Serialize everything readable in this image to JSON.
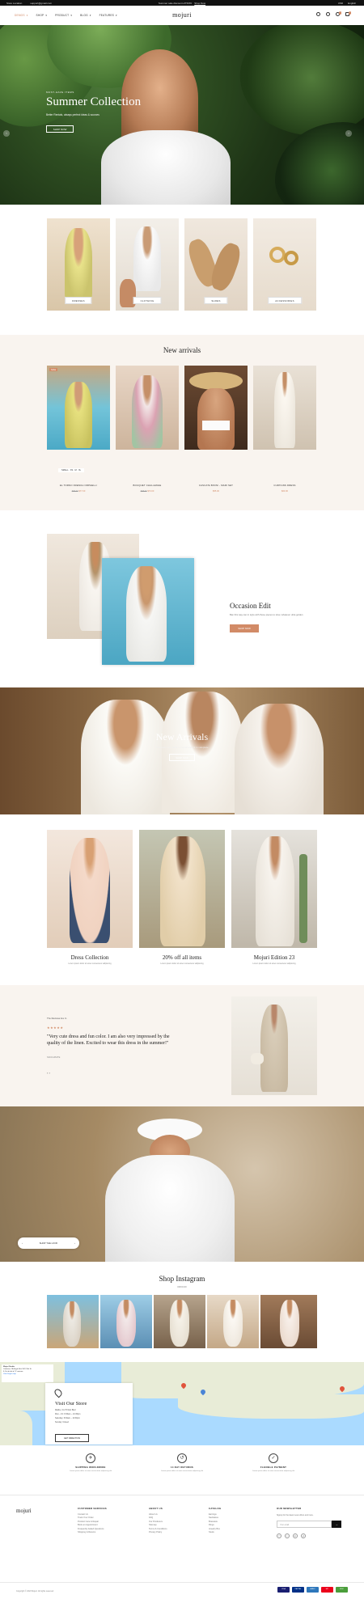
{
  "topbar": {
    "left": [
      "Store Location",
      "support@gmail.com"
    ],
    "center_text": "Summer sale discount off 50%!",
    "center_link": "Shop Now",
    "currency": "USD",
    "language": "English"
  },
  "header": {
    "logo": "mojuri",
    "nav": [
      "DEMOS",
      "SHOP",
      "PRODUCT",
      "BLOG",
      "FEATURES"
    ],
    "wishlist_count": "0",
    "cart_count": "0"
  },
  "hero": {
    "subtitle": "MUST-HAVE ITEMS",
    "title": "Summer Collection",
    "description": "Better Rentals, always perfect ideas & sources",
    "button": "SHOP NOW",
    "prev": "‹",
    "next": "›"
  },
  "categories": [
    {
      "label": "DRESSES"
    },
    {
      "label": "CLOTHING"
    },
    {
      "label": "SHOES"
    },
    {
      "label": "ACCESSORIES"
    }
  ],
  "new_arrivals": {
    "title": "New arrivals",
    "sizes": "SMALL · XS · M · XL",
    "products": [
      {
        "name": "EL TORNO FRENCH ORPHELLI",
        "old": "$95.00",
        "price": "$77.00",
        "badge": "SALE"
      },
      {
        "name": "BOUQUET CHALLENGE",
        "old": "$98.00",
        "price": "$73.00",
        "badge": ""
      },
      {
        "name": "CASCATA BIKINI - MARI SET",
        "old": "",
        "price": "$55.00",
        "badge": ""
      },
      {
        "name": "CURTAINS DRESS",
        "old": "",
        "price": "$63.00",
        "badge": ""
      }
    ]
  },
  "occasion": {
    "title": "Occasion Edit",
    "description": "Ban this way can in style with those pieces to slow, whatever ultra golden",
    "button": "SHOP NOW"
  },
  "banner2": {
    "title": "New Arrivals",
    "description": "Duis aute irure dolor in reprehenderit in voluptate",
    "button": "SHOP NOW"
  },
  "collections": [
    {
      "title": "Dress Collection",
      "desc": "Lorem ipsum dolor sit amet consectetur adipiscing"
    },
    {
      "title": "20% off all items",
      "desc": "Lorem ipsum dolor sit amet consectetur adipiscing"
    },
    {
      "title": "Mojuri Edition 23",
      "desc": "Lorem ipsum dolor sit amet consectetur adipiscing"
    }
  ],
  "testimonial": {
    "label": "The Reviews Are In",
    "stars": "★★★★★",
    "quote": "\"Very cute dress and fun color. I am also very impressed by the quality of the linen. Excited to wear this dress in the summer!\"",
    "author": "SAVIA WHITE",
    "nav": "‹   ›"
  },
  "banner3": {
    "pill_text": "SHOP THE LOOK",
    "pill_prev": "‹",
    "pill_next": "›"
  },
  "instagram": {
    "title": "Shop Instagram",
    "subtitle": "#MOJURI"
  },
  "map": {
    "info_title": "Mojuri Studio",
    "info_line1": "Oakview, CA Eagle Bch 9012 8th St",
    "info_line2": "4.6 ★★★★★  12 reviews",
    "info_link": "View larger map",
    "store_title": "Visit Our Store",
    "store_lines": [
      "Malibu, CA 70 Meri Blvd",
      "Mon – Fri: 8:30am – 10:30pm",
      "Saturday: 8:30am – 10:30pm",
      "Sunday: Closed"
    ],
    "store_button": "GET DIRECTION"
  },
  "features": [
    {
      "icon": "✈",
      "title": "SHIPPING WORLDWIDE",
      "desc": "Lorem ipsum dolor sit amet consectetur adipiscing elit"
    },
    {
      "icon": "↺",
      "title": "14 DAY RETURNS",
      "desc": "Lorem ipsum dolor sit amet consectetur adipiscing elit"
    },
    {
      "icon": "✓",
      "title": "FLEXIBLE PAYMENT",
      "desc": "Lorem ipsum dolor sit amet consectetur adipiscing elit"
    }
  ],
  "footer": {
    "logo": "mojuri",
    "columns": [
      {
        "title": "CUSTOMER SERVICES",
        "links": [
          "Contact Us",
          "Track Your Order",
          "Product Care & Repair",
          "Book an Appointment",
          "Frequently Asked Questions",
          "Shipping & Returns"
        ]
      },
      {
        "title": "ABOUT US",
        "links": [
          "About Us",
          "FAQ",
          "Our Producers",
          "Sitemap",
          "Terms & Conditions",
          "Privacy Policy"
        ]
      },
      {
        "title": "CATALOG",
        "links": [
          "Earrings",
          "Necklaces",
          "Bracelets",
          "Rings",
          "Jewelry Box",
          "Studs"
        ]
      }
    ],
    "newsletter_title": "OUR NEWSLETTER",
    "newsletter_desc": "Signup for the latest news offers and more.",
    "newsletter_placeholder": "Your email",
    "newsletter_btn": "→",
    "socials": [
      "f",
      "t",
      "in",
      "yt"
    ],
    "copyright": "Copyright © 2023 Mojuri. All rights reserved",
    "payments": [
      "VISA",
      "PAYPAL",
      "AMEX",
      "MC",
      "DISC"
    ]
  }
}
